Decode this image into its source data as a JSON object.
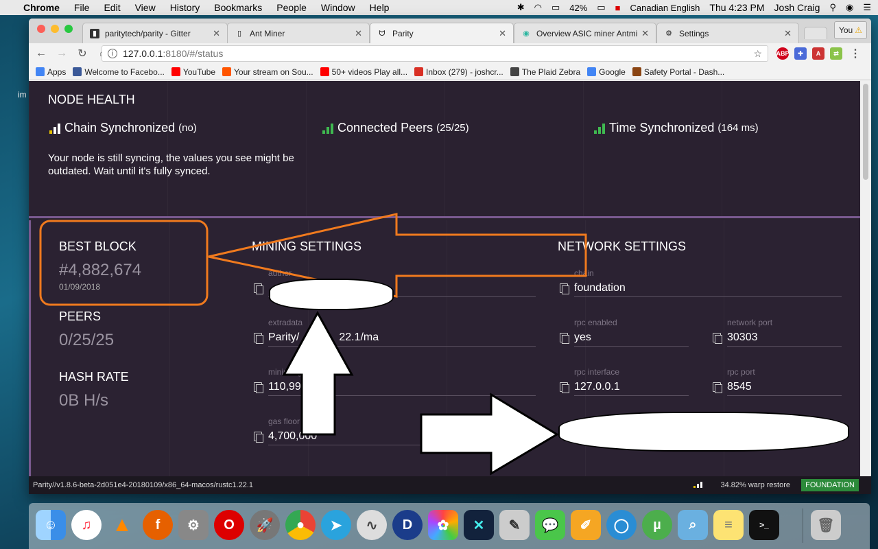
{
  "menubar": {
    "app": "Chrome",
    "items": [
      "File",
      "Edit",
      "View",
      "History",
      "Bookmarks",
      "People",
      "Window",
      "Help"
    ],
    "battery": "42%",
    "input_source": "Canadian English",
    "clock": "Thu 4:23 PM",
    "user": "Josh Craig"
  },
  "desktop": {
    "icon_label": "im"
  },
  "browser": {
    "tabs": [
      {
        "label": "paritytech/parity - Gitter",
        "icon": "gitter-icon"
      },
      {
        "label": "Ant Miner",
        "icon": "page-icon"
      },
      {
        "label": "Parity",
        "icon": "parity-icon"
      },
      {
        "label": "Overview ASIC miner Antmi",
        "icon": "overview-icon"
      },
      {
        "label": "Settings",
        "icon": "gear-icon"
      }
    ],
    "profile": "You",
    "url_host": "127.0.0.1",
    "url_path": ":8180/#/status",
    "bookmarks": [
      {
        "label": "Apps",
        "color": "#4285f4"
      },
      {
        "label": "Welcome to Facebo...",
        "color": "#3b5998"
      },
      {
        "label": "YouTube",
        "color": "#ff0000"
      },
      {
        "label": "Your stream on Sou...",
        "color": "#ff5500"
      },
      {
        "label": "50+ videos Play all...",
        "color": "#ff0000"
      },
      {
        "label": "Inbox (279) - joshcr...",
        "color": "#d93025"
      },
      {
        "label": "The Plaid Zebra",
        "color": "#444444"
      },
      {
        "label": "Google",
        "color": "#4285f4"
      },
      {
        "label": "Safety Portal - Dash...",
        "color": "#8b4513"
      }
    ]
  },
  "node_health": {
    "title": "NODE HEALTH",
    "chain": {
      "label": "Chain Synchronized",
      "status": "(no)"
    },
    "peers": {
      "label": "Connected Peers",
      "status": "(25/25)"
    },
    "time": {
      "label": "Time Synchronized",
      "status": "(164 ms)"
    },
    "message": "Your node is still syncing, the values you see might be outdated. Wait until it's fully synced."
  },
  "stats": {
    "best_block": {
      "label": "BEST BLOCK",
      "value": "#4,882,674",
      "date": "01/09/2018"
    },
    "peers": {
      "label": "PEERS",
      "value": "0/25/25"
    },
    "hash_rate": {
      "label": "HASH RATE",
      "value": "0B H/s"
    }
  },
  "mining": {
    "title": "MINING SETTINGS",
    "author_label": "author",
    "extradata_label": "extradata",
    "extradata_value": "Parity/",
    "extradata_value_tail": "22.1/ma",
    "mingasprice_label": "minimurg",
    "mingasprice_value": "110,99",
    "gasfloor_label": "gas floor",
    "gasfloor_value": "4,700,000"
  },
  "network": {
    "title": "NETWORK SETTINGS",
    "chain_label": "chain",
    "chain_value": "foundation",
    "rpc_enabled_label": "rpc enabled",
    "rpc_enabled_value": "yes",
    "network_port_label": "network port",
    "network_port_value": "30303",
    "rpc_interface_label": "rpc interface",
    "rpc_interface_value": "127.0.0.1",
    "rpc_port_label": "rpc port",
    "rpc_port_value": "8545"
  },
  "statusbar": {
    "version": "Parity//v1.8.6-beta-2d051e4-20180109/x86_64-macos/rustc1.22.1",
    "warp": "34.82% warp restore",
    "chain": "FOUNDATION"
  },
  "colors": {
    "annotation_orange": "#f07a1e",
    "signal_green": "#3fb950",
    "signal_yellow": "#e5c100",
    "badge_green": "#2c8a3a"
  },
  "dock": [
    "Finder",
    "iTunes",
    "VLC",
    "Firefox",
    "System Preferences",
    "Opera",
    "Launchpad",
    "Chrome",
    "Telegram",
    "Sierra",
    "DigiByte",
    "Photos",
    "Exodus",
    "Script Editor",
    "WeChat",
    "Pages",
    "Cloud",
    "uTorrent",
    "Preview",
    "Notes",
    "Terminal",
    "Trash"
  ]
}
